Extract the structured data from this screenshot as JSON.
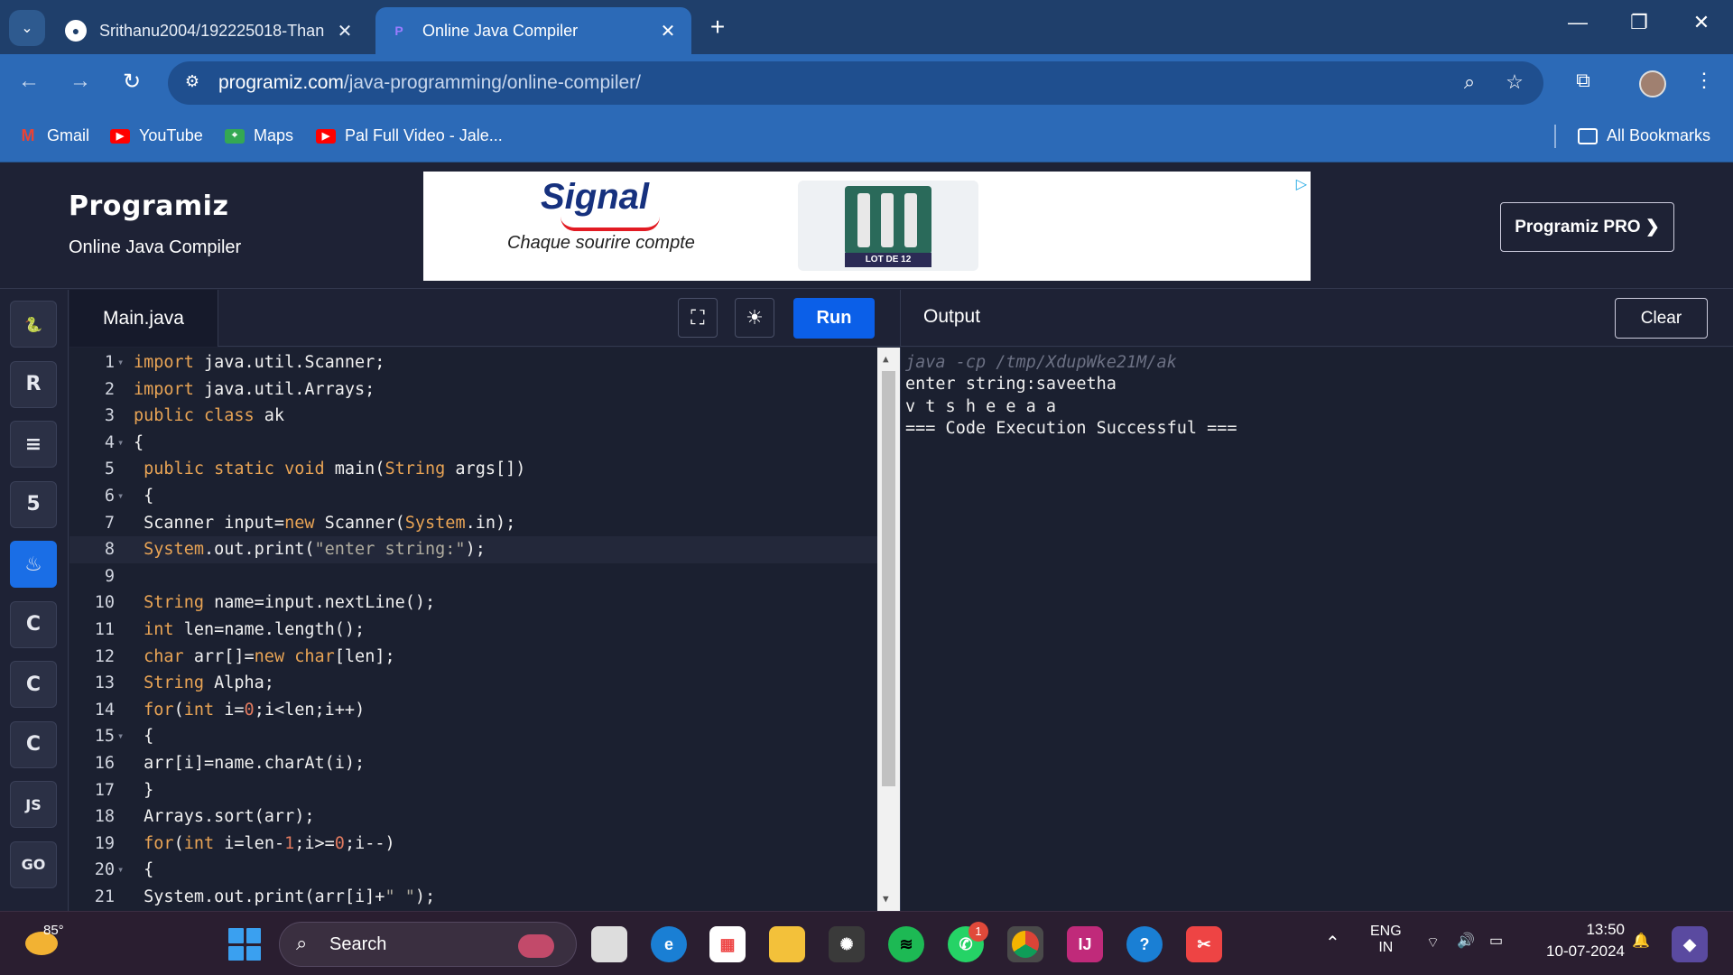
{
  "browser": {
    "tabs": [
      {
        "title": "Srithanu2004/192225018-Than",
        "icon": "github-icon",
        "active": false
      },
      {
        "title": "Online Java Compiler",
        "icon": "programiz-icon",
        "active": true
      }
    ],
    "url_host": "programiz.com",
    "url_path": "/java-programming/online-compiler/",
    "bookmarks": [
      {
        "label": "Gmail",
        "icon": "gmail-icon"
      },
      {
        "label": "YouTube",
        "icon": "youtube-icon"
      },
      {
        "label": "Maps",
        "icon": "maps-icon"
      },
      {
        "label": "Pal Full Video - Jale...",
        "icon": "youtube-icon"
      }
    ],
    "all_bookmarks": "All Bookmarks"
  },
  "site": {
    "logo": "Programiz",
    "subtitle": "Online Java Compiler",
    "pro_button": "Programiz PRO ❯",
    "ad": {
      "brand": "Signal",
      "tagline": "Chaque sourire compte",
      "product_label": "LOT DE 12"
    }
  },
  "languages": [
    {
      "name": "python-icon",
      "glyph": "🐍",
      "active": false
    },
    {
      "name": "r-icon",
      "glyph": "R",
      "active": false
    },
    {
      "name": "sql-icon",
      "glyph": "≡",
      "active": false
    },
    {
      "name": "html5-icon",
      "glyph": "5",
      "active": false
    },
    {
      "name": "java-icon",
      "glyph": "♨",
      "active": true
    },
    {
      "name": "c-icon",
      "glyph": "C",
      "active": false
    },
    {
      "name": "cpp-icon",
      "glyph": "C",
      "active": false
    },
    {
      "name": "csharp-icon",
      "glyph": "C",
      "active": false
    },
    {
      "name": "js-icon",
      "glyph": "JS",
      "active": false
    },
    {
      "name": "go-icon",
      "glyph": "GO",
      "active": false
    }
  ],
  "editor": {
    "file_tab": "Main.java",
    "run_label": "Run",
    "lines": [
      {
        "n": "1",
        "fold": true,
        "html": "<span class=\"kw\">import</span> java.util.Scanner;"
      },
      {
        "n": "2",
        "fold": false,
        "html": "<span class=\"kw\">import</span> java.util.Arrays;"
      },
      {
        "n": "3",
        "fold": false,
        "html": "<span class=\"kw\">public class</span> ak"
      },
      {
        "n": "4",
        "fold": true,
        "html": "{"
      },
      {
        "n": "5",
        "fold": false,
        "html": " <span class=\"kw\">public static void</span> main(<span class=\"kw\">String</span> args[])"
      },
      {
        "n": "6",
        "fold": true,
        "html": " {"
      },
      {
        "n": "7",
        "fold": false,
        "html": " Scanner input=<span class=\"kw\">new</span> Scanner(<span class=\"kw\">System</span>.in);"
      },
      {
        "n": "8",
        "fold": false,
        "hl": true,
        "html": " <span class=\"kw\">System</span>.out.print(<span class=\"str\">\"enter string:\"</span>);"
      },
      {
        "n": "9",
        "fold": false,
        "html": ""
      },
      {
        "n": "10",
        "fold": false,
        "html": " <span class=\"kw\">String</span> name=input.nextLine();"
      },
      {
        "n": "11",
        "fold": false,
        "html": " <span class=\"kw\">int</span> len=name.length();"
      },
      {
        "n": "12",
        "fold": false,
        "html": " <span class=\"kw\">char</span> arr[]=<span class=\"kw\">new char</span>[len];"
      },
      {
        "n": "13",
        "fold": false,
        "html": " <span class=\"kw\">String</span> Alpha;"
      },
      {
        "n": "14",
        "fold": false,
        "html": " <span class=\"kw\">for</span>(<span class=\"kw\">int</span> i=<span class=\"num\">0</span>;i&lt;len;i++)"
      },
      {
        "n": "15",
        "fold": true,
        "html": " {"
      },
      {
        "n": "16",
        "fold": false,
        "html": " arr[i]=name.charAt(i);"
      },
      {
        "n": "17",
        "fold": false,
        "html": " }"
      },
      {
        "n": "18",
        "fold": false,
        "html": " Arrays.sort(arr);"
      },
      {
        "n": "19",
        "fold": false,
        "html": " <span class=\"kw\">for</span>(<span class=\"kw\">int</span> i=len-<span class=\"num\">1</span>;i>=<span class=\"num\">0</span>;i--)"
      },
      {
        "n": "20",
        "fold": true,
        "html": " {"
      },
      {
        "n": "21",
        "fold": false,
        "html": " System.out.print(arr[i]+<span class=\"str\">\" \"</span>);"
      }
    ]
  },
  "output": {
    "title": "Output",
    "clear_label": "Clear",
    "lines": [
      {
        "text": "java -cp /tmp/XdupWke21M/ak",
        "cmd": true
      },
      {
        "text": "enter string:saveetha",
        "cmd": false
      },
      {
        "text": "v t s h e e a a",
        "cmd": false
      },
      {
        "text": "=== Code Execution Successful ===",
        "cmd": false
      }
    ]
  },
  "taskbar": {
    "temperature": "85°",
    "search_label": "Search",
    "whatsapp_badge": "1",
    "lang_top": "ENG",
    "lang_bottom": "IN",
    "time": "13:50",
    "date": "10-07-2024"
  }
}
